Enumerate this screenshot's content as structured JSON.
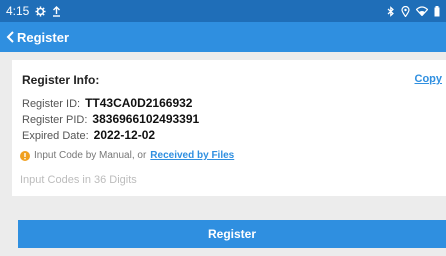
{
  "status_bar": {
    "time": "4:15",
    "left_icons": [
      "settings-gear-icon",
      "upload-icon"
    ],
    "right_icons": [
      "bluetooth-icon",
      "location-icon",
      "wifi-icon",
      "battery-icon"
    ]
  },
  "app_bar": {
    "title": "Register"
  },
  "register_info": {
    "title": "Register Info:",
    "copy_label": "Copy",
    "id_label": "Register ID:",
    "id_value": "TT43CA0D2166932",
    "pid_label": "Register PID:",
    "pid_value": "3836966102493391",
    "expired_label": "Expired Date:",
    "expired_value": "2022-12-02"
  },
  "hint": {
    "text": "Input Code by Manual, or",
    "link": "Received by Files"
  },
  "code_input": {
    "placeholder": "Input Codes in 36 Digits",
    "value": ""
  },
  "register_button": {
    "label": "Register"
  },
  "colors": {
    "status_bar": "#1f6eb8",
    "app_bar": "#2f8fe0",
    "accent": "#2f8fe0",
    "warning": "#f0a020"
  }
}
